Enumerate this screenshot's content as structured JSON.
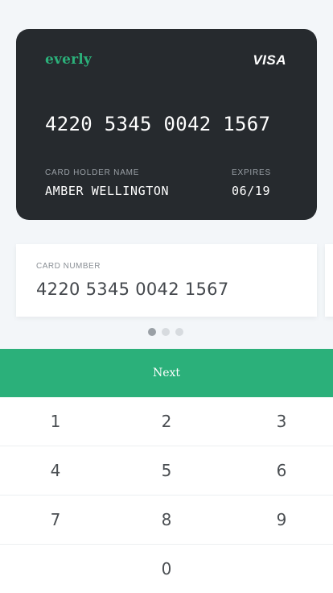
{
  "card": {
    "brand": "everly",
    "network": "VISA",
    "number": "4220 5345 0042 1567",
    "holder_label": "CARD HOLDER NAME",
    "holder_name": "AMBER WELLINGTON",
    "expires_label": "EXPIRES",
    "expires_value": "06/19"
  },
  "field": {
    "label": "CARD NUMBER",
    "value": "4220 5345 0042 1567"
  },
  "pager": {
    "active_index": 0,
    "count": 3
  },
  "next_button": {
    "label": "Next"
  },
  "keypad": {
    "rows": [
      [
        "1",
        "2",
        "3"
      ],
      [
        "4",
        "5",
        "6"
      ],
      [
        "7",
        "8",
        "9"
      ],
      [
        "",
        "0",
        ""
      ]
    ]
  },
  "colors": {
    "accent": "#2bb07a",
    "card_bg": "#262a2e",
    "page_bg": "#f3f6f9"
  }
}
